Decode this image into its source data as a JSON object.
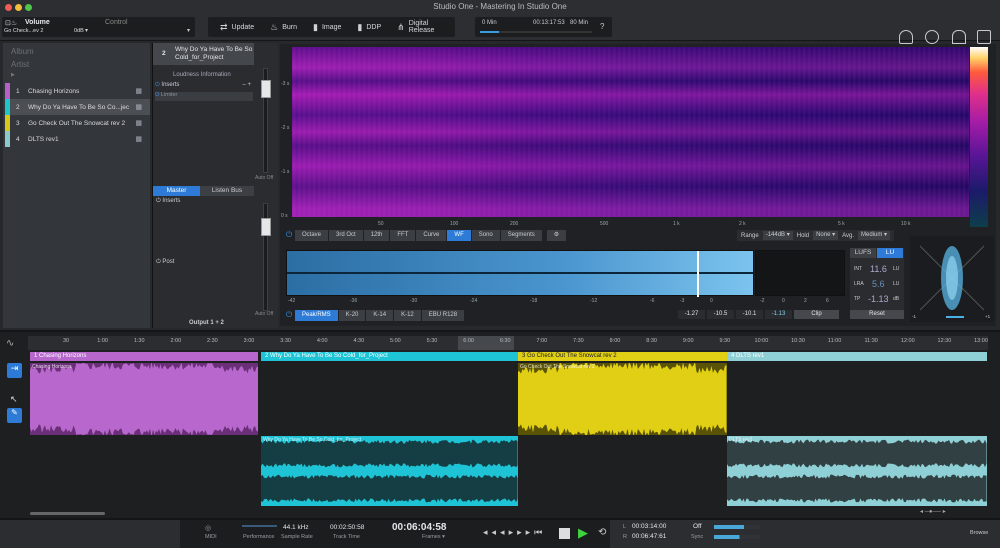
{
  "window": {
    "title": "Studio One - Mastering In Studio One"
  },
  "toolbar": {
    "volume_label": "Volume",
    "control_label": "Control",
    "track_name": "Go Check...ev 2",
    "gain": "0dB",
    "actions": [
      {
        "label": "Update",
        "icon": "update-icon"
      },
      {
        "label": "Burn",
        "icon": "burn-icon"
      },
      {
        "label": "Image",
        "icon": "image-icon"
      },
      {
        "label": "DDP",
        "icon": "ddp-icon"
      },
      {
        "label": "Digital Release",
        "icon": "digital-release-icon"
      }
    ],
    "time_start": "0 Min",
    "time_total": "00:13:17:53",
    "time_end": "80 Min",
    "help": "?",
    "progress": 0.17
  },
  "album": {
    "album_placeholder": "Album",
    "artist_placeholder": "Artist",
    "tracks": [
      {
        "num": "1",
        "title": "Chasing Horizons",
        "color": "#b660c8"
      },
      {
        "num": "2",
        "title": "Why Do Ya Have To Be So Co...jec",
        "color": "#1fc6c9"
      },
      {
        "num": "3",
        "title": "Go Check Out The Snowcat rev 2",
        "color": "#d7c819"
      },
      {
        "num": "4",
        "title": "DLTS rev1",
        "color": "#8cc9cf"
      }
    ]
  },
  "inspector": {
    "track_num": "2",
    "track_title": "Why Do Ya Have To Be So Cold_for_Project",
    "loudness_info": "Loudness Information",
    "inserts": "Inserts",
    "limiter": "Limiter",
    "auto_off": "Auto Off",
    "master_tab": "Master",
    "listen_tab": "Listen Bus",
    "master_inserts": "Inserts",
    "post": "Post",
    "auto_off2": "Auto Off",
    "output": "Output 1 + 2"
  },
  "spectrum": {
    "y_labels": [
      "-3 s",
      "-2 s",
      "-1 s",
      "0 s"
    ],
    "freq_labels": [
      "50",
      "100",
      "200",
      "500",
      "1 k",
      "2 k",
      "5 k",
      "10 k"
    ],
    "modes": [
      "Octave",
      "3rd Oct",
      "12th",
      "FFT",
      "Curve",
      "WF",
      "Sono",
      "Segments"
    ],
    "active_mode": "WF",
    "range_label": "Range",
    "range_value": "-144dB",
    "hold_label": "Hold",
    "hold_value": "None",
    "avg_label": "Avg.",
    "avg_value": "Medium"
  },
  "meter": {
    "scale": [
      "-42",
      "-36",
      "-30",
      "-24",
      "-18",
      "-12",
      "-6",
      "-3",
      "0"
    ],
    "peak_scale": [
      "-2",
      "0",
      "2",
      "6"
    ],
    "modes": [
      "Peak/RMS",
      "K-20",
      "K-14",
      "K-12",
      "EBU R128"
    ],
    "active_mode": "Peak/RMS",
    "readouts": [
      "-1.27",
      "-10.5",
      "-10.1",
      "-1.13"
    ],
    "clip": "Clip"
  },
  "loudness": {
    "unit_lufs": "LUFS",
    "unit_lu": "LU",
    "int_label": "INT",
    "int_value": "11.6",
    "lra_label": "LRA",
    "lra_value": "5.6",
    "tp_label": "TP",
    "tp_value": "-1.13",
    "tp_unit": "dB",
    "lu": "LU",
    "reset": "Reset"
  },
  "correlation": {
    "left": "-1",
    "right": "+1"
  },
  "arrange": {
    "ruler": [
      "30",
      "1:00",
      "1:30",
      "2:00",
      "2:30",
      "3:00",
      "3:30",
      "4:00",
      "4:30",
      "5:00",
      "5:30",
      "6:00",
      "6:30",
      "7:00",
      "7:30",
      "8:00",
      "8:30",
      "9:00",
      "9:30",
      "10:00",
      "10:30",
      "11:00",
      "11:30",
      "12:00",
      "12:30",
      "13:00"
    ],
    "clips": [
      {
        "header": "1  Chasing Horizons",
        "name": "Chasing Horizons",
        "color": "#b868cc",
        "dark": "#6a2f78"
      },
      {
        "header": "2  Why Do Ya Have To Be So Cold_for_Project",
        "name": "Why Do Ya Have To Be So Cold_for_Project",
        "color": "#1ec4d6",
        "dark": "#0d4a55"
      },
      {
        "header": "3  Go Check Out The Snowcat rev 2",
        "name": "Go Check Out The Snowcat rev 2",
        "color": "#e0cf14",
        "dark": "#5a5306"
      },
      {
        "header": "4  DLTS rev1",
        "name": "DLTS rev1",
        "color": "#8fd0d6",
        "dark": "#2f5558"
      }
    ]
  },
  "transport": {
    "midi": "MIDI",
    "performance": "Performance",
    "sample_rate_value": "44.1 kHz",
    "sample_rate_label": "Sample Rate",
    "track_time_value": "00:02:50:58",
    "track_time_label": "Track Time",
    "main_time": "00:06:04:58",
    "frames": "Frames",
    "loop_l": "00:03:14:00",
    "loop_r": "00:06:47:61",
    "l": "L",
    "r": "R",
    "sync_value": "Off",
    "sync_label": "Sync",
    "browse": "Browse"
  }
}
